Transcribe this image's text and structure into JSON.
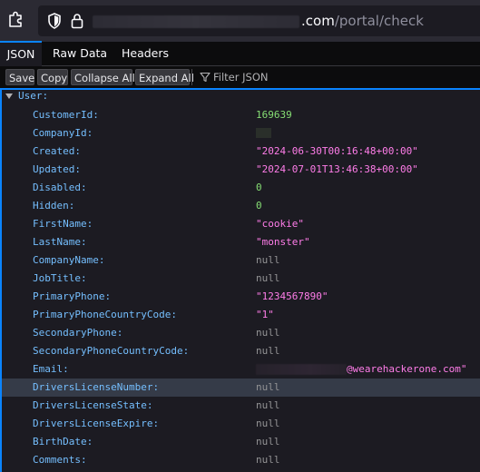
{
  "browser": {
    "url_domain_suffix": ".com",
    "url_path": "/portal/check"
  },
  "viewer": {
    "tabs": [
      {
        "label": "JSON",
        "active": true
      },
      {
        "label": "Raw Data",
        "active": false
      },
      {
        "label": "Headers",
        "active": false
      }
    ],
    "toolbar": {
      "save": "Save",
      "copy": "Copy",
      "collapse_all": "Collapse All",
      "expand_all": "Expand All",
      "filter_placeholder": "Filter JSON"
    }
  },
  "json": {
    "root_key": "User:",
    "rows": [
      {
        "key": "CustomerId:",
        "value": "169639",
        "kind": "num"
      },
      {
        "key": "CompanyId:",
        "value": "",
        "kind": "redacted-small"
      },
      {
        "key": "Created:",
        "value": "\"2024-06-30T00:16:48+00:00\"",
        "kind": "str"
      },
      {
        "key": "Updated:",
        "value": "\"2024-07-01T13:46:38+00:00\"",
        "kind": "str"
      },
      {
        "key": "Disabled:",
        "value": "0",
        "kind": "num"
      },
      {
        "key": "Hidden:",
        "value": "0",
        "kind": "num"
      },
      {
        "key": "FirstName:",
        "value": "\"cookie\"",
        "kind": "str"
      },
      {
        "key": "LastName:",
        "value": "\"monster\"",
        "kind": "str"
      },
      {
        "key": "CompanyName:",
        "value": "null",
        "kind": "nul"
      },
      {
        "key": "JobTitle:",
        "value": "null",
        "kind": "nul"
      },
      {
        "key": "PrimaryPhone:",
        "value": "\"1234567890\"",
        "kind": "str"
      },
      {
        "key": "PrimaryPhoneCountryCode:",
        "value": "\"1\"",
        "kind": "str"
      },
      {
        "key": "SecondaryPhone:",
        "value": "null",
        "kind": "nul"
      },
      {
        "key": "SecondaryPhoneCountryCode:",
        "value": "null",
        "kind": "nul"
      },
      {
        "key": "Email:",
        "value": "@wearehackerone.com\"",
        "kind": "email"
      },
      {
        "key": "DriversLicenseNumber:",
        "value": "null",
        "kind": "nul",
        "highlighted": true
      },
      {
        "key": "DriversLicenseState:",
        "value": "null",
        "kind": "nul"
      },
      {
        "key": "DriversLicenseExpire:",
        "value": "null",
        "kind": "nul"
      },
      {
        "key": "BirthDate:",
        "value": "null",
        "kind": "nul"
      },
      {
        "key": "Comments:",
        "value": "null",
        "kind": "nul"
      }
    ]
  },
  "colors": {
    "accent": "#0a84ff",
    "key": "#75bfff",
    "number": "#86de74",
    "string": "#ff7de9",
    "null": "#939395"
  }
}
